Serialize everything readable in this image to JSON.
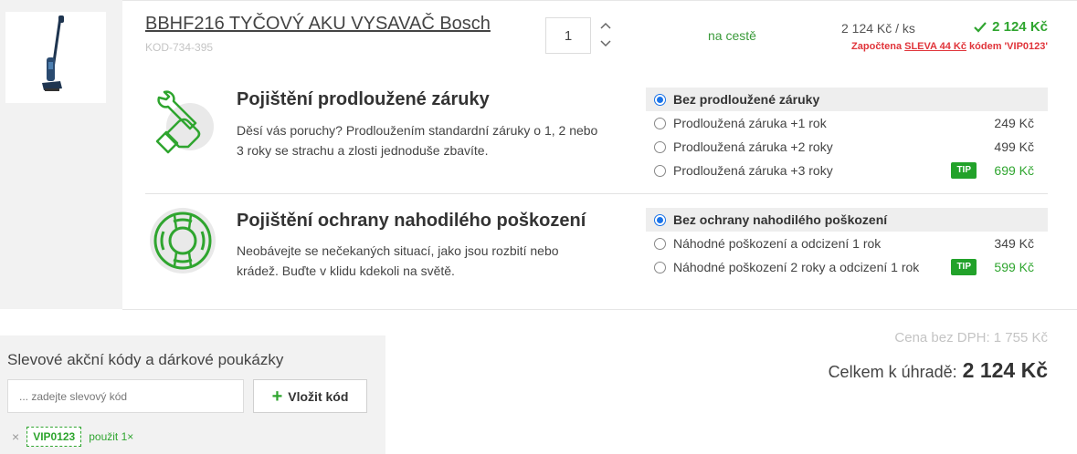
{
  "product": {
    "name": "BBHF216 TYČOVÝ AKU VYSAVAČ Bosch",
    "code": "KOD-734-395",
    "quantity": "1",
    "availability": "na cestě",
    "unit_price": "2 124 Kč / ks",
    "total_price": "2 124 Kč",
    "discount": {
      "prefix": "Započtena",
      "amount": "SLEVA 44 Kč",
      "suffix": "kódem 'VIP0123'"
    }
  },
  "warranty": {
    "title": "Pojištění prodloužené záruky",
    "description": "Děsí vás poruchy? Prodloužením standardní záruky o 1, 2 nebo 3 roky se strachu a zlosti jednoduše zbavíte.",
    "options": [
      {
        "label": "Bez prodloužené záruky",
        "price": "",
        "selected": true,
        "tip": false
      },
      {
        "label": "Prodloužená záruka +1 rok",
        "price": "249 Kč",
        "selected": false,
        "tip": false
      },
      {
        "label": "Prodloužená záruka +2 roky",
        "price": "499 Kč",
        "selected": false,
        "tip": false
      },
      {
        "label": "Prodloužená záruka +3 roky",
        "price": "699 Kč",
        "selected": false,
        "tip": true
      }
    ]
  },
  "damage": {
    "title": "Pojištění ochrany nahodilého poškození",
    "description": "Neobávejte se nečekaných situací, jako jsou rozbití nebo krádež. Buďte v klidu kdekoli na světě.",
    "options": [
      {
        "label": "Bez ochrany nahodilého poškození",
        "price": "",
        "selected": true,
        "tip": false
      },
      {
        "label": "Náhodné poškození a odcizení 1 rok",
        "price": "349 Kč",
        "selected": false,
        "tip": false
      },
      {
        "label": "Náhodné poškození 2 roky a odcizení 1 rok",
        "price": "599 Kč",
        "selected": false,
        "tip": true
      }
    ]
  },
  "tip_label": "TIP",
  "summary": {
    "price_without_vat": "Cena bez DPH: 1 755 Kč",
    "total_label": "Celkem k úhradě:",
    "total_value": "2 124 Kč"
  },
  "coupon": {
    "heading": "Slevové akční kódy a dárkové poukázky",
    "placeholder": "... zadejte slevový kód",
    "button_label": "Vložit kód",
    "applied_code": "VIP0123",
    "applied_note": "použit 1×"
  },
  "icons": {
    "qty_up": "chevron-up-icon",
    "qty_down": "chevron-down-icon",
    "total_check": "check-icon",
    "warranty": "wrench-hand-icon",
    "damage": "lifebuoy-icon",
    "coupon_add": "plus-icon",
    "coupon_remove": "close-icon"
  },
  "colors": {
    "accent_green": "#2fa52f",
    "discount_red": "#e0343a",
    "radio_blue": "#1a73e8"
  }
}
